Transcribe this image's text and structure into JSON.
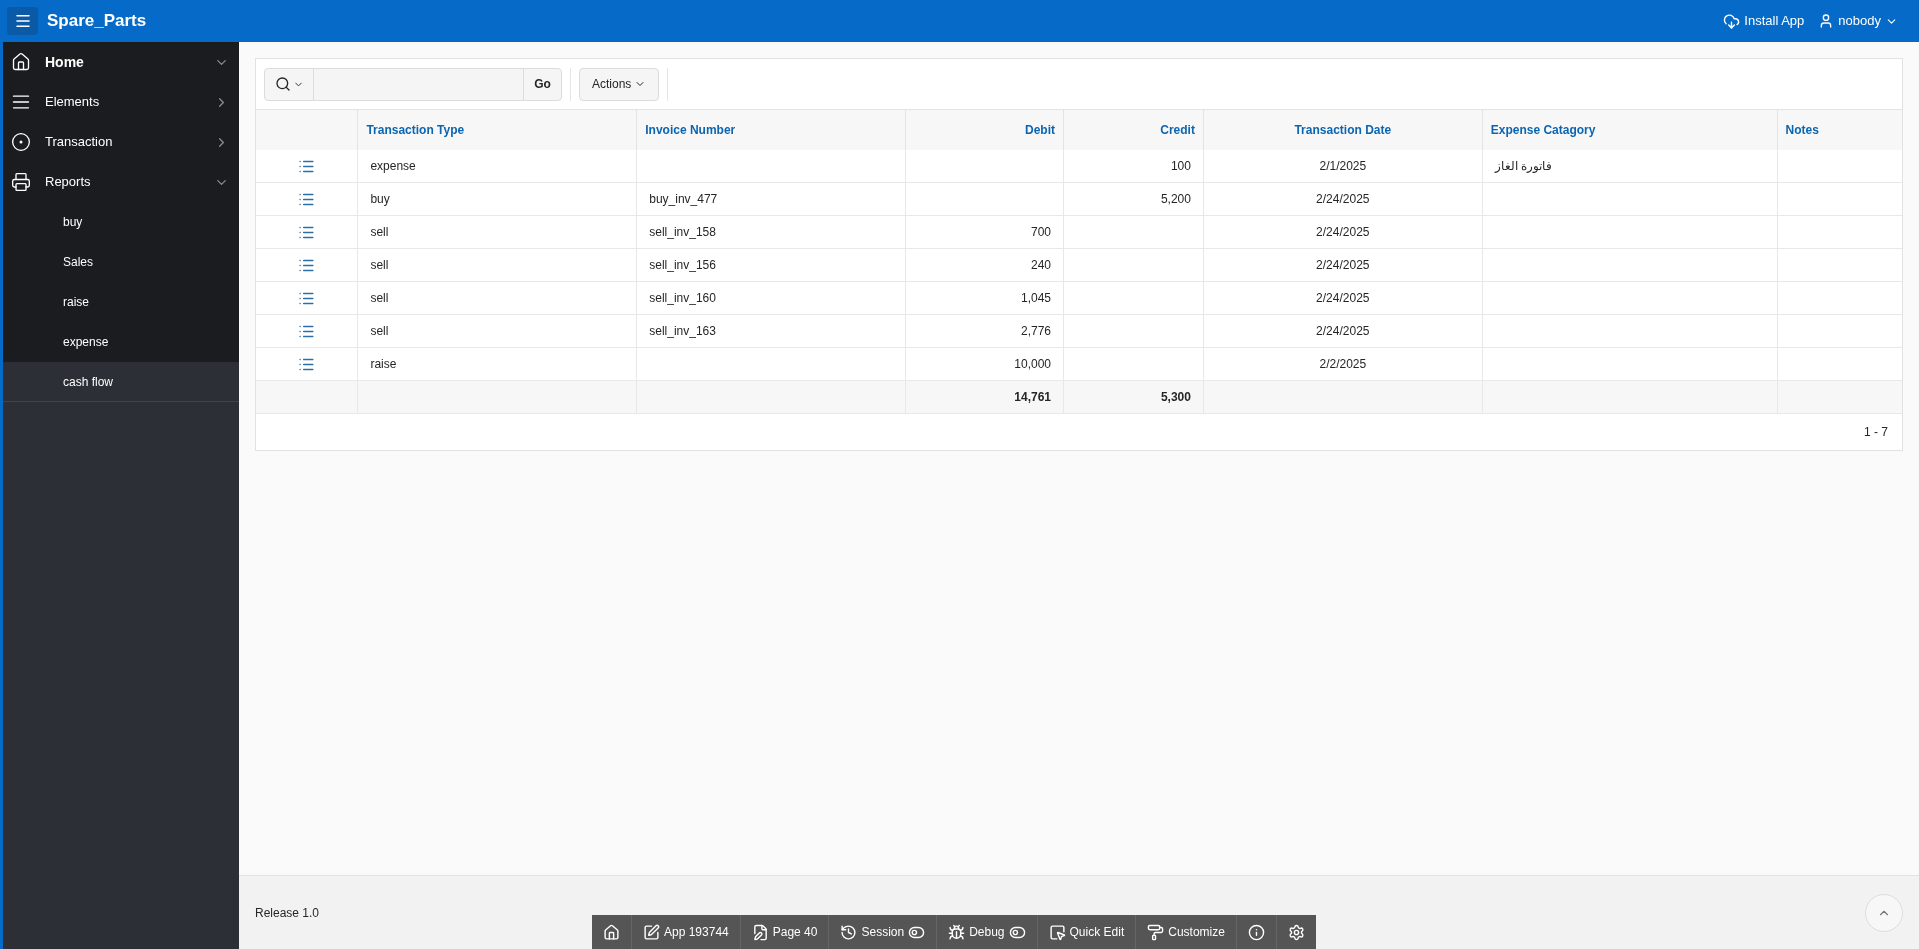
{
  "header": {
    "app_title": "Spare_Parts",
    "install_label": "Install App",
    "user_label": "nobody"
  },
  "sidebar": {
    "items": [
      {
        "label": "Home",
        "kind": "home",
        "expanded": true,
        "bold": true
      },
      {
        "label": "Elements",
        "kind": "elements",
        "expanded": false,
        "bold": false
      },
      {
        "label": "Transaction",
        "kind": "transaction",
        "expanded": false,
        "bold": false
      },
      {
        "label": "Reports",
        "kind": "reports",
        "expanded": true,
        "bold": false,
        "children": [
          {
            "label": "buy",
            "selected": false
          },
          {
            "label": "Sales",
            "selected": false
          },
          {
            "label": "raise",
            "selected": false
          },
          {
            "label": "expense",
            "selected": false
          },
          {
            "label": "cash flow",
            "selected": true
          }
        ]
      }
    ]
  },
  "toolbar": {
    "go_label": "Go",
    "actions_label": "Actions"
  },
  "table": {
    "columns": [
      "Transaction Type",
      "Invoice Number",
      "Debit",
      "Credit",
      "Transaction Date",
      "Expense Catagory",
      "Notes"
    ],
    "rows": [
      [
        "expense",
        null,
        null,
        "100",
        "2/1/2025",
        "فاتورة الغاز",
        null
      ],
      [
        "buy",
        "buy_inv_477",
        null,
        "5,200",
        "2/24/2025",
        null,
        null
      ],
      [
        "sell",
        "sell_inv_158",
        "700",
        null,
        "2/24/2025",
        null,
        null
      ],
      [
        "sell",
        "sell_inv_156",
        "240",
        null,
        "2/24/2025",
        null,
        null
      ],
      [
        "sell",
        "sell_inv_160",
        "1,045",
        null,
        "2/24/2025",
        null,
        null
      ],
      [
        "sell",
        "sell_inv_163",
        "2,776",
        null,
        "2/24/2025",
        null,
        null
      ],
      [
        "raise",
        null,
        "10,000",
        null,
        "2/2/2025",
        null,
        null
      ]
    ],
    "totals": {
      "debit": "14,761",
      "credit": "5,300"
    },
    "pagination": "1 - 7"
  },
  "footer": {
    "release": "Release 1.0"
  },
  "dev_toolbar": [
    {
      "kind": "home"
    },
    {
      "kind": "edit",
      "label": "App 193744"
    },
    {
      "kind": "page",
      "label": "Page 40"
    },
    {
      "kind": "session",
      "label": "Session"
    },
    {
      "kind": "debug",
      "label": "Debug"
    },
    {
      "kind": "quickedit",
      "label": "Quick Edit"
    },
    {
      "kind": "customize",
      "label": "Customize"
    },
    {
      "kind": "info"
    },
    {
      "kind": "settings"
    }
  ]
}
